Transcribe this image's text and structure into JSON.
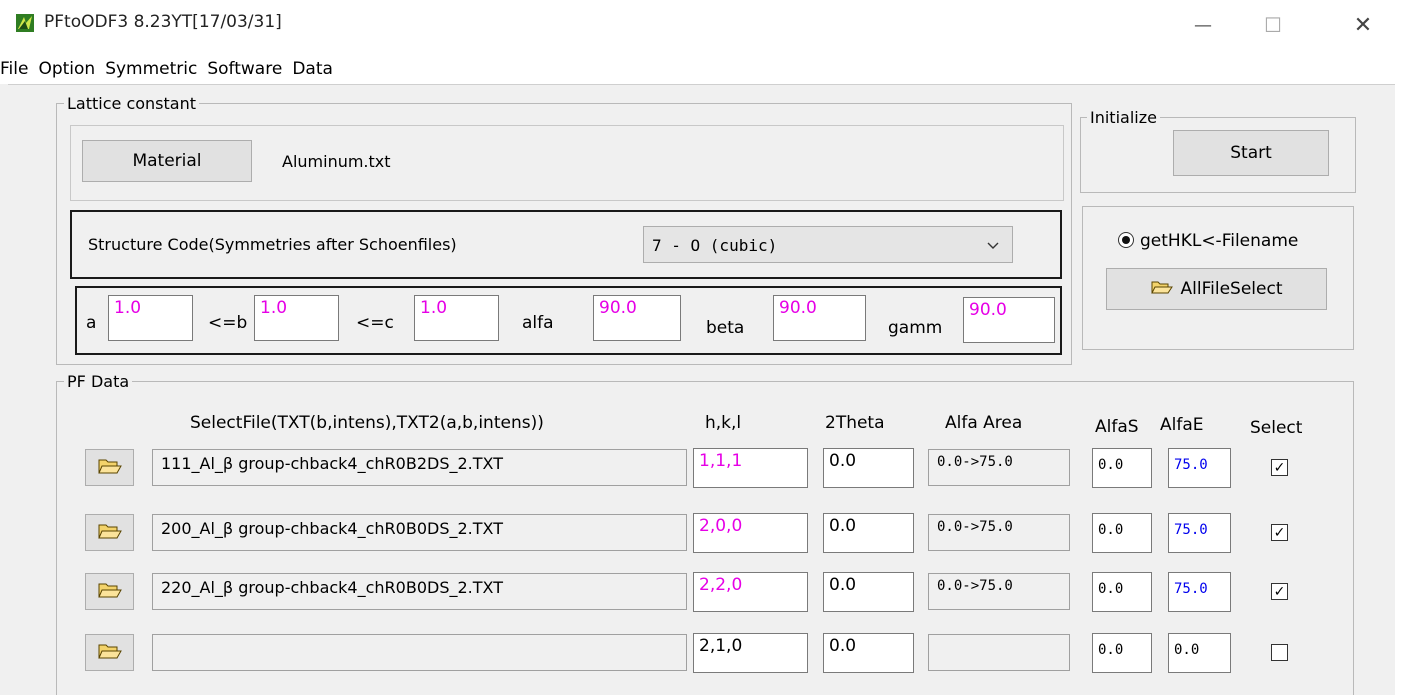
{
  "window": {
    "title": "PFtoODF3 8.23YT[17/03/31]",
    "minimize_glyph": "—",
    "maximize_glyph": "☐",
    "close_glyph": "✕"
  },
  "menu": {
    "file": "File",
    "option": "Option",
    "symmetric": "Symmetric",
    "software": "Software",
    "data": "Data"
  },
  "lattice": {
    "group_label": "Lattice constant",
    "material_button": "Material",
    "material_file": "Aluminum.txt",
    "structure_label": "Structure Code(Symmetries after Schoenfiles)",
    "structure_value": "7 - O (cubic)",
    "a_label": "a",
    "a_value": "1.0",
    "b_label": "<=b",
    "b_value": "1.0",
    "c_label": "<=c",
    "c_value": "1.0",
    "alfa_label": "alfa",
    "alfa_value": "90.0",
    "beta_label": "beta",
    "beta_value": "90.0",
    "gamm_label": "gamm",
    "gamm_value": "90.0"
  },
  "initialize": {
    "group_label": "Initialize",
    "start_button": "Start",
    "radio_label": "getHKL<-Filename",
    "radio_selected": true,
    "allfile_button": "AllFileSelect"
  },
  "pf": {
    "group_label": "PF Data",
    "headers": {
      "file": "SelectFile(TXT(b,intens),TXT2(a,b,intens))",
      "hkl": "h,k,l",
      "theta": "2Theta",
      "alfa_area": "Alfa Area",
      "alfas": "AlfaS",
      "alfae": "AlfaE",
      "select": "Select"
    },
    "rows": [
      {
        "file": "111_Al_β group-chback4_chR0B2DS_2.TXT",
        "hkl": "1,1,1",
        "theta": "0.0",
        "alfa_area": "0.0->75.0",
        "alfas": "0.0",
        "alfae": "75.0",
        "checked": "✓"
      },
      {
        "file": "200_Al_β group-chback4_chR0B0DS_2.TXT",
        "hkl": "2,0,0",
        "theta": "0.0",
        "alfa_area": "0.0->75.0",
        "alfas": "0.0",
        "alfae": "75.0",
        "checked": "✓"
      },
      {
        "file": "220_Al_β group-chback4_chR0B0DS_2.TXT",
        "hkl": "2,2,0",
        "theta": "0.0",
        "alfa_area": "0.0->75.0",
        "alfas": "0.0",
        "alfae": "75.0",
        "checked": "✓"
      },
      {
        "file": "",
        "hkl": "2,1,0",
        "theta": "0.0",
        "alfa_area": "",
        "alfas": "0.0",
        "alfae": "0.0",
        "checked": ""
      }
    ]
  },
  "colors": {
    "accent_magenta": "#e600e6",
    "accent_blue": "#0000ee",
    "window_bg": "#f0f0f0"
  }
}
